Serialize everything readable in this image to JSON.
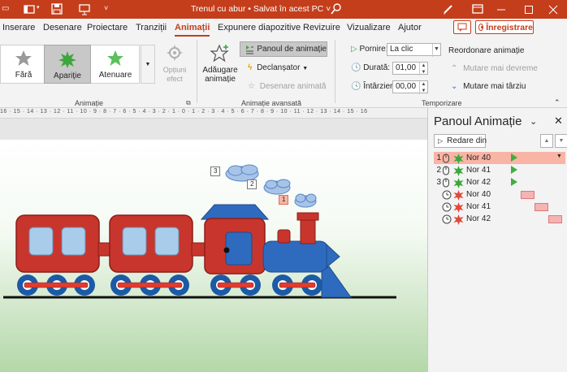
{
  "titlebar": {
    "doc_title": "Trenul cu abur • Salvat în acest PC ˅",
    "colors": {
      "accent": "#c43e1c"
    }
  },
  "tabs": [
    {
      "label": "Inserare"
    },
    {
      "label": "Desenare"
    },
    {
      "label": "Proiectare"
    },
    {
      "label": "Tranziții"
    },
    {
      "label": "Animații",
      "active": true
    },
    {
      "label": "Expunere diapozitive"
    },
    {
      "label": "Revizuire"
    },
    {
      "label": "Vizualizare"
    },
    {
      "label": "Ajutor"
    }
  ],
  "record_label": "Înregistrare",
  "ribbon": {
    "animations": {
      "items": [
        {
          "label": "Fără",
          "icon": "star-gray-icon"
        },
        {
          "label": "Apariție",
          "icon": "star-burst-icon",
          "selected": true
        },
        {
          "label": "Atenuare",
          "icon": "star-green-icon"
        }
      ],
      "options_label": "Opțiuni efect",
      "group_label": "Animație"
    },
    "advanced": {
      "add_label": "Adăugare animație",
      "panel_label": "Panoul de animație",
      "trigger_label": "Declanșator",
      "painter_label": "Desenare animată",
      "group_label": "Animație avansată"
    },
    "timing": {
      "start_label": "Pornire:",
      "start_value": "La clic",
      "duration_label": "Durată:",
      "duration_value": "01,00",
      "delay_label": "Întârziere:",
      "delay_value": "00,00",
      "reorder_label": "Reordonare animație",
      "move_earlier_label": "Mutare mai devreme",
      "move_later_label": "Mutare mai târziu",
      "group_label": "Temporizare"
    }
  },
  "ruler": {
    "text": "16 · 15 · 14 · 13 · 12 · 11 · 10 · 9 · 8 · 7 · 6 · 5 · 4 · 3 · 2 · 1 · 0 · 1 · 2 · 3 · 4 · 5 · 6 · 7 · 8 · 9 · 10 · 11 · 12 · 13 · 14 · 15 · 16"
  },
  "slide": {
    "tags": [
      "3",
      "2",
      "1"
    ]
  },
  "pane": {
    "title": "Panoul Animație",
    "play_label": "Redare din",
    "rows": [
      {
        "num": "1",
        "name": "Nor 40",
        "trigger": "click",
        "effect": "entrance",
        "selected": true
      },
      {
        "num": "2",
        "name": "Nor 41",
        "trigger": "click",
        "effect": "entrance"
      },
      {
        "num": "3",
        "name": "Nor 42",
        "trigger": "click",
        "effect": "entrance"
      },
      {
        "num": "",
        "name": "Nor 40",
        "trigger": "after",
        "effect": "exit"
      },
      {
        "num": "",
        "name": "Nor 41",
        "trigger": "after",
        "effect": "exit"
      },
      {
        "num": "",
        "name": "Nor 42",
        "trigger": "after",
        "effect": "exit"
      }
    ]
  }
}
